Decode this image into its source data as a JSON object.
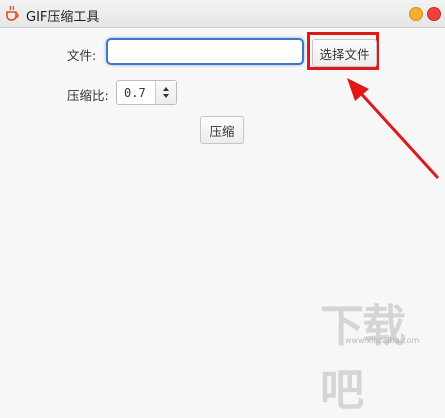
{
  "window": {
    "title": "GIF压缩工具",
    "app_icon": "coffee-cup-icon"
  },
  "form": {
    "file_label": "文件:",
    "file_value": "",
    "choose_button": "选择文件",
    "ratio_label": "压缩比:",
    "ratio_value": "0.7",
    "compress_button": "压缩"
  },
  "annotation": {
    "highlight_color": "#e01818"
  },
  "watermark": {
    "text": "下载吧",
    "subtext": "www.xiazaiba.com"
  }
}
